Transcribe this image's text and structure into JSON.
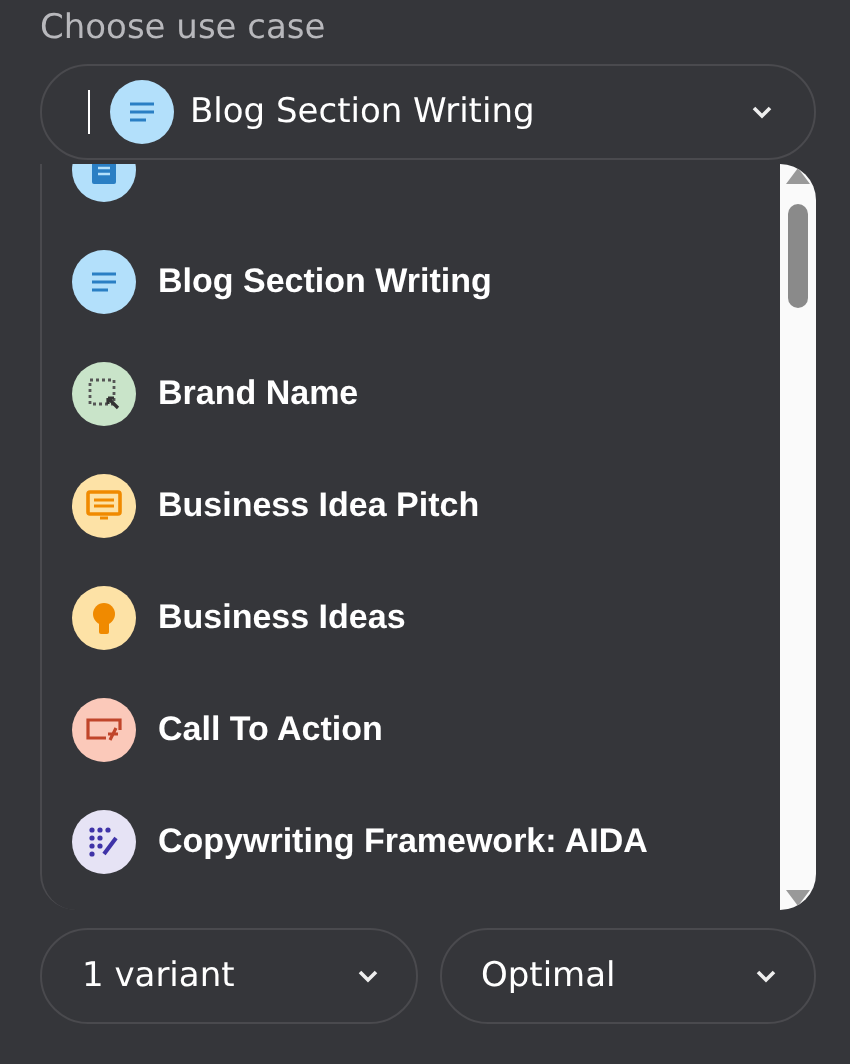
{
  "label": "Choose use case",
  "use_case": {
    "value": "Blog Section Writing",
    "color": "#b3e0fb"
  },
  "options": [
    {
      "color": "#b3e0fb"
    },
    {
      "label": "Blog Section Writing",
      "color": "#b3e0fb"
    },
    {
      "label": "Brand Name",
      "color": "#c9e4c9"
    },
    {
      "label": "Business Idea Pitch",
      "color": "#fde2a6"
    },
    {
      "label": "Business Ideas",
      "color": "#fde2a6"
    },
    {
      "label": "Call To Action",
      "color": "#fbc9ba"
    },
    {
      "label": "Copywriting Framework: AIDA",
      "color": "#e6e3f5"
    }
  ],
  "variants": {
    "value": "1 variant"
  },
  "quality": {
    "value": "Optimal"
  }
}
